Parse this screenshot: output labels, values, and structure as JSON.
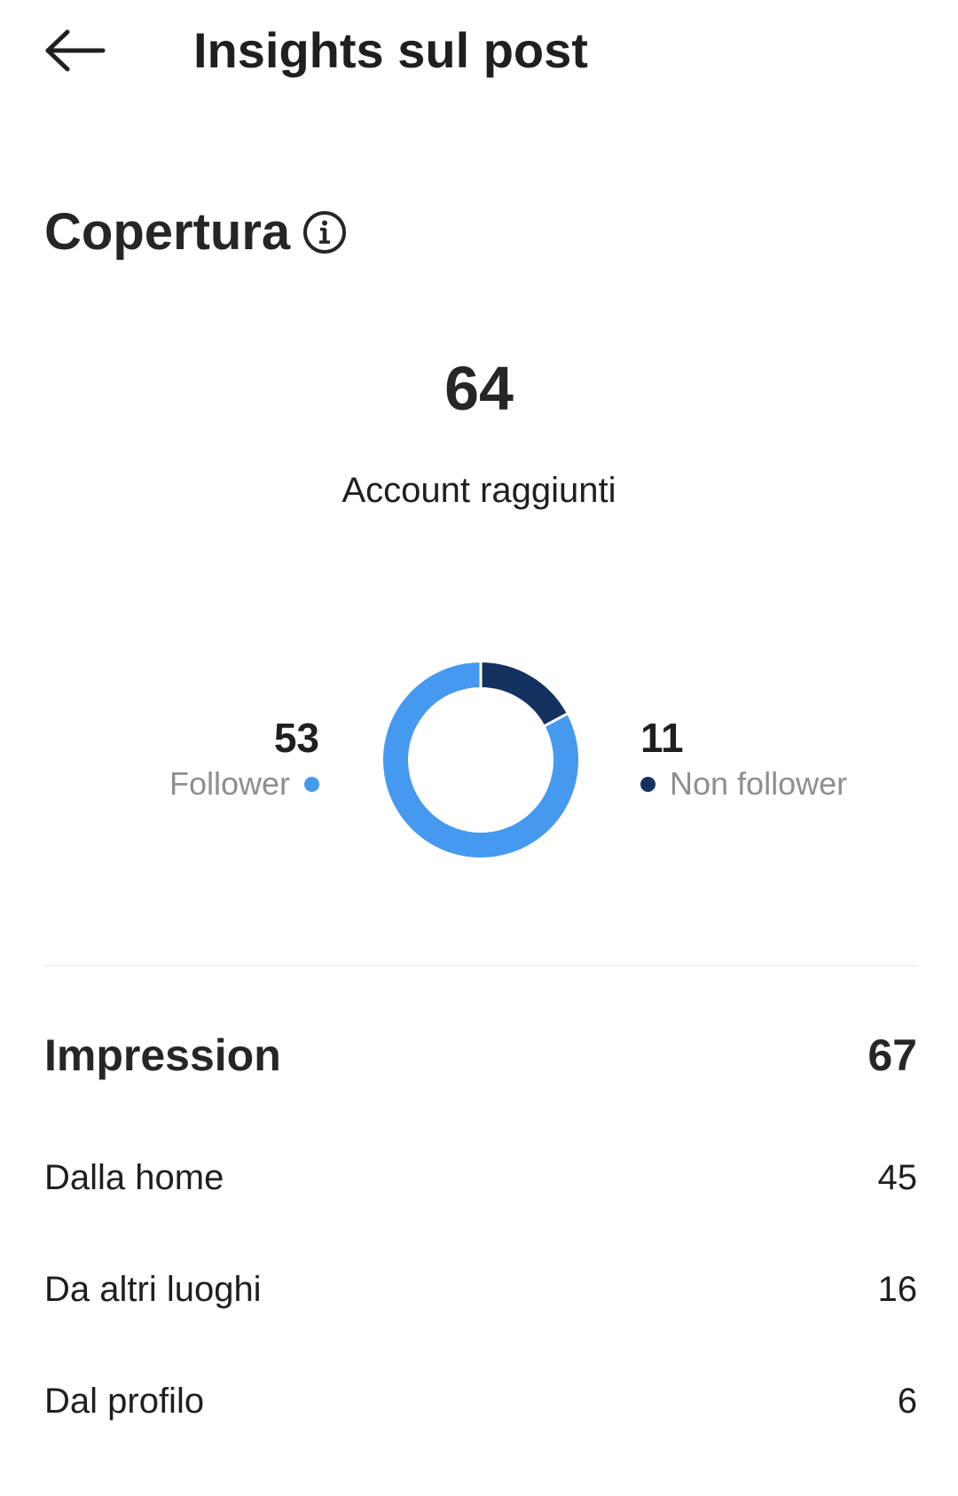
{
  "header": {
    "title": "Insights sul post",
    "back_icon": "arrow-left-icon"
  },
  "reach": {
    "title": "Copertura",
    "info_icon": "info-icon",
    "total": "64",
    "total_label": "Account raggiunti",
    "followers": {
      "value": "53",
      "label": "Follower",
      "color": "#4599ef"
    },
    "non_followers": {
      "value": "11",
      "label": "Non follower",
      "color": "#14325f"
    }
  },
  "impressions": {
    "label": "Impression",
    "value": "67",
    "rows": [
      {
        "label": "Dalla home",
        "value": "45"
      },
      {
        "label": "Da altri luoghi",
        "value": "16"
      },
      {
        "label": "Dal profilo",
        "value": "6"
      }
    ]
  }
}
